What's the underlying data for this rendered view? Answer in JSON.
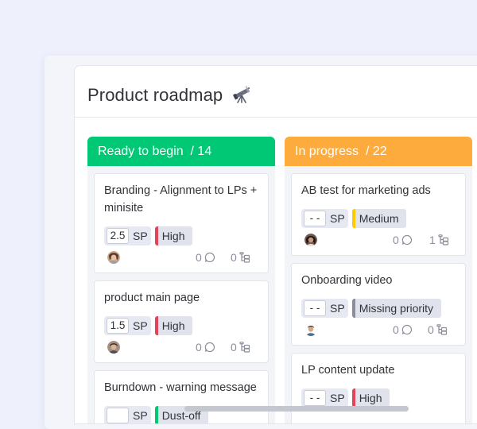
{
  "board": {
    "title": "Product roadmap",
    "title_icon": "telescope-icon"
  },
  "columns": [
    {
      "name": "Ready to begin",
      "count_label": "/ 14",
      "color": "#00c875",
      "cards": [
        {
          "title": "Branding  - Alignment to LPs + minisite",
          "sp_value": "2.5",
          "sp_label": "SP",
          "priority": "High",
          "priority_color": "#e2445c",
          "comments": "0",
          "subitems": "0"
        },
        {
          "title": "product main page",
          "sp_value": "1.5",
          "sp_label": "SP",
          "priority": "High",
          "priority_color": "#e2445c",
          "comments": "0",
          "subitems": "0"
        },
        {
          "title": "Burndown - warning message",
          "sp_value": "",
          "sp_label": "SP",
          "priority": "Dust-off",
          "priority_color": "#00c875",
          "comments": "",
          "subitems": ""
        }
      ]
    },
    {
      "name": "In progress",
      "count_label": "/ 22",
      "color": "#fdab3d",
      "cards": [
        {
          "title": "AB test for marketing ads",
          "sp_value": "- -",
          "sp_label": "SP",
          "priority": "Medium",
          "priority_color": "#ffcb00",
          "comments": "0",
          "subitems": "1"
        },
        {
          "title": "Onboarding video",
          "sp_value": "- -",
          "sp_label": "SP",
          "priority": "Missing priority",
          "priority_color": "#8a8d9a",
          "comments": "0",
          "subitems": "0"
        },
        {
          "title": "LP content update",
          "sp_value": "- -",
          "sp_label": "SP",
          "priority": "High",
          "priority_color": "#e2445c",
          "comments": "",
          "subitems": ""
        }
      ]
    }
  ]
}
